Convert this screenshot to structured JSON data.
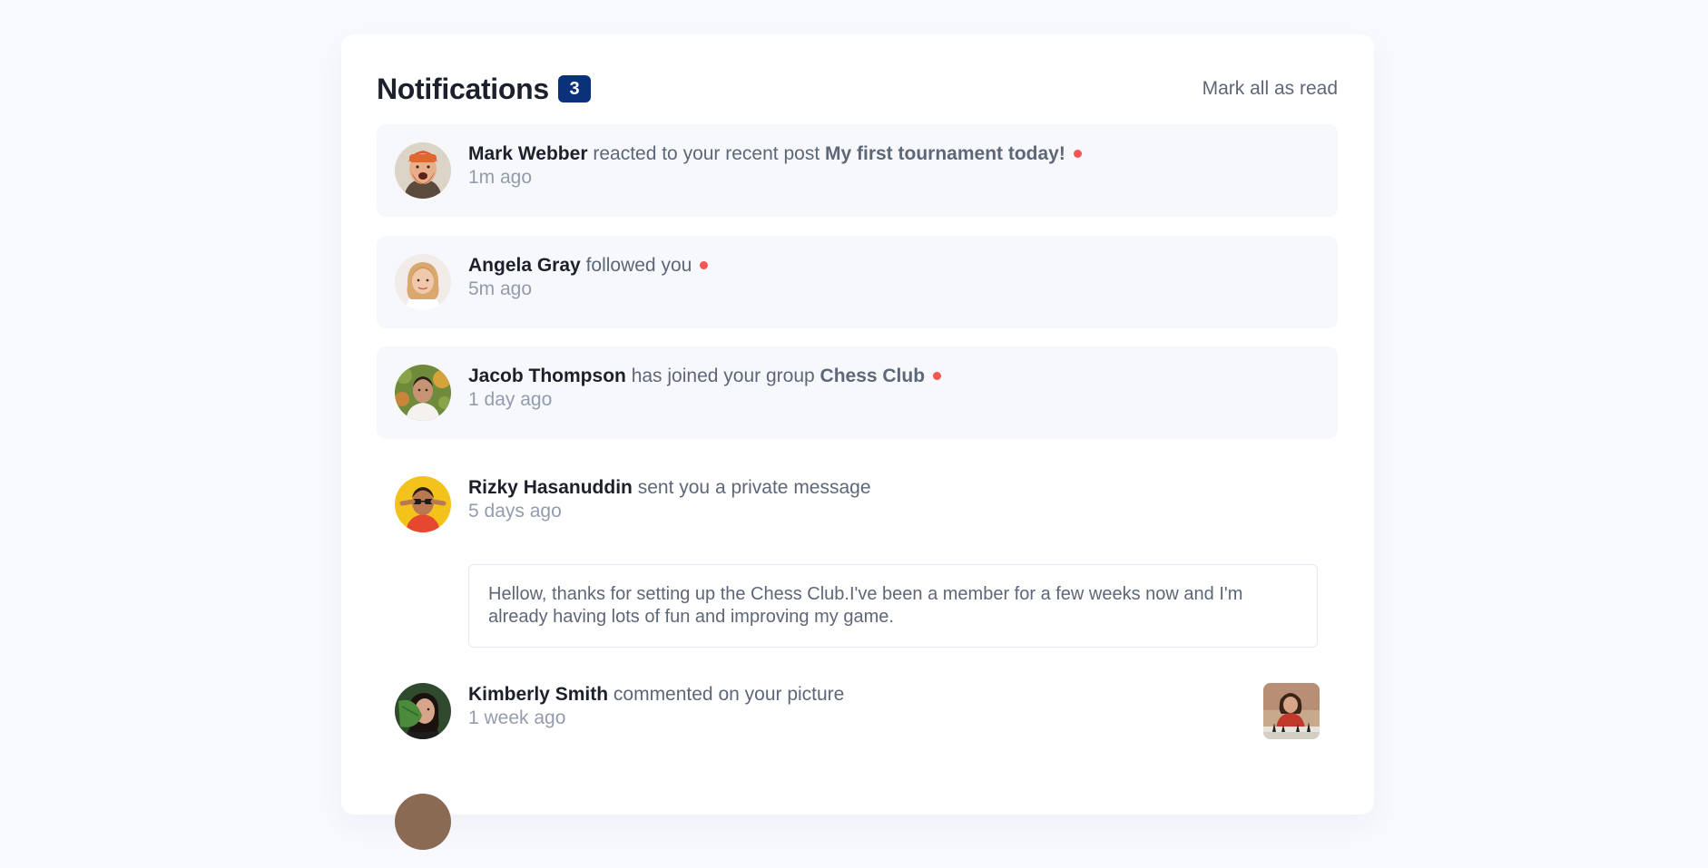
{
  "header": {
    "title": "Notifications",
    "badge_count": "3",
    "mark_all_label": "Mark all as read"
  },
  "notifications": [
    {
      "user": "Mark Webber",
      "action": "reacted to your recent post",
      "target": "My first tournament today!",
      "time": "1m ago",
      "unread": true
    },
    {
      "user": "Angela Gray",
      "action": "followed you",
      "target": "",
      "time": "5m ago",
      "unread": true
    },
    {
      "user": "Jacob Thompson",
      "action": "has joined your group",
      "target": "Chess Club",
      "time": "1 day ago",
      "unread": true
    },
    {
      "user": "Rizky Hasanuddin",
      "action": "sent you a private message",
      "target": "",
      "time": "5 days ago",
      "unread": false,
      "message": "Hellow, thanks for setting up the Chess Club.I've been a member for a few weeks now and I'm already having lots of fun and improving my game."
    },
    {
      "user": "Kimberly Smith",
      "action": "commented on your picture",
      "target": "",
      "time": "1 week ago",
      "unread": false
    }
  ],
  "colors": {
    "badge_bg": "#0a327b",
    "unread_dot": "#f65552",
    "unread_bg": "#f6f8fc",
    "page_bg": "#f7f9fd"
  }
}
